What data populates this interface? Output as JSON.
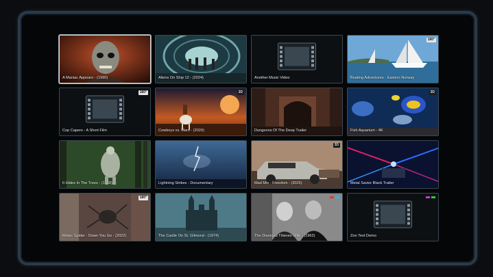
{
  "tiles": [
    {
      "title": "A Maniac Appears - (1990)",
      "badge": "",
      "thumb": "maniac",
      "selected": true
    },
    {
      "title": "Aliens On Ship 12 - (2024)",
      "badge": "",
      "thumb": "aliens"
    },
    {
      "title": "Another Music Video",
      "badge": "",
      "thumb": "placeholder"
    },
    {
      "title": "Boating Adventures - Eastern Norway",
      "badge": "180°",
      "thumb": "boat"
    },
    {
      "title": "Cop Capers - A Short Film",
      "badge": "180°",
      "thumb": "placeholder"
    },
    {
      "title": "Cowboys vs. Mars - (2020)",
      "badge": "3D",
      "thumb": "cowboy"
    },
    {
      "title": "Dungeons Of The Deep Trailer",
      "badge": "",
      "thumb": "dungeon"
    },
    {
      "title": "Fish Aquarium - 4K",
      "badge": "3D",
      "thumb": "fish"
    },
    {
      "title": "It Hides In The Trees - (1968)",
      "badge": "",
      "thumb": "forest"
    },
    {
      "title": "Lightning Strikes - Documentary",
      "badge": "",
      "thumb": "storm"
    },
    {
      "title": "Mad Mix - Freedom - (2025)",
      "badge": "3D",
      "thumb": "car"
    },
    {
      "title": "Metal Savior Black Trailer",
      "badge": "",
      "thumb": "neon"
    },
    {
      "title": "Mister Spider - Down You Go - (2022)",
      "badge": "180°",
      "thumb": "spider"
    },
    {
      "title": "The Castle On St. Gilmond - (1974)",
      "badge": "",
      "thumb": "castle"
    },
    {
      "title": "The Diamond Thieves Wife - (1962)",
      "badge": "",
      "thumb": "bw",
      "dots": [
        "#e53935",
        "#29b6f6"
      ]
    },
    {
      "title": "Zoo Test Demo",
      "badge": "",
      "thumb": "placeholder",
      "dots": [
        "#c83cc8",
        "#2ecc40"
      ]
    }
  ]
}
